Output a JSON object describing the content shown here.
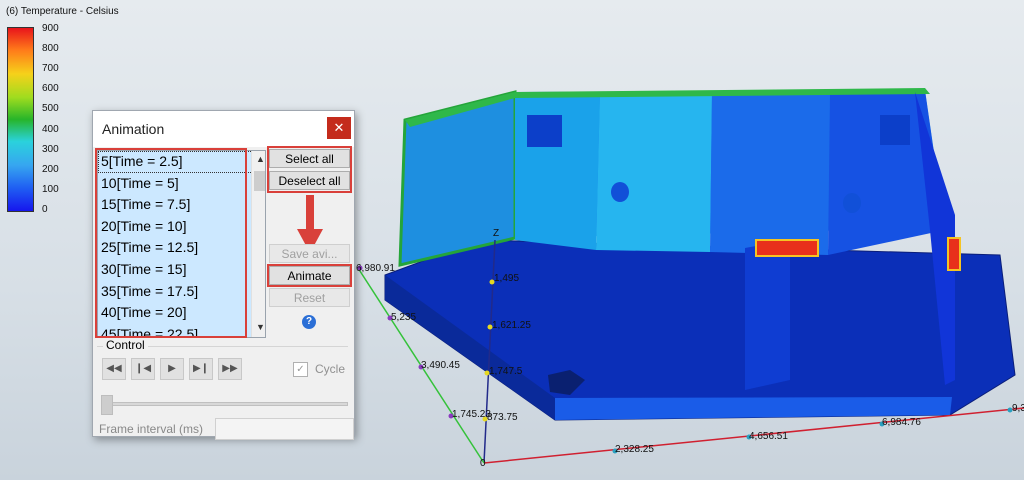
{
  "legend": {
    "title": "(6) Temperature - Celsius",
    "labels": [
      "900",
      "800",
      "700",
      "600",
      "500",
      "400",
      "300",
      "200",
      "100",
      "0"
    ]
  },
  "axes": {
    "z_label": "Z",
    "z_ticks": [
      "1,495",
      "1,621.25",
      "1,747.5",
      "873.75",
      "0"
    ],
    "y_ticks": [
      "6,980.91",
      "5,235",
      "3,490.45",
      "1,745.23"
    ],
    "x_ticks": [
      "2,328.25",
      "4,656.51",
      "6,984.76",
      "9,3"
    ]
  },
  "dialog": {
    "title": "Animation",
    "close_icon": "close-icon",
    "frames": [
      "5[Time = 2.5]",
      "10[Time = 5]",
      "15[Time = 7.5]",
      "20[Time = 10]",
      "25[Time = 12.5]",
      "30[Time = 15]",
      "35[Time = 17.5]",
      "40[Time = 20]",
      "45[Time = 22.5]"
    ],
    "buttons": {
      "select_all": "Select all",
      "deselect_all": "Deselect all",
      "save_avi": "Save avi...",
      "animate": "Animate",
      "reset": "Reset"
    },
    "control": {
      "label": "Control",
      "cycle_label": "Cycle",
      "cycle_checked": true,
      "frame_interval_label": "Frame interval (ms)",
      "frame_interval_value": ""
    }
  },
  "colors": {
    "highlight": "#d9403a",
    "selection": "#cce8ff",
    "close_button": "#c42b1c"
  }
}
